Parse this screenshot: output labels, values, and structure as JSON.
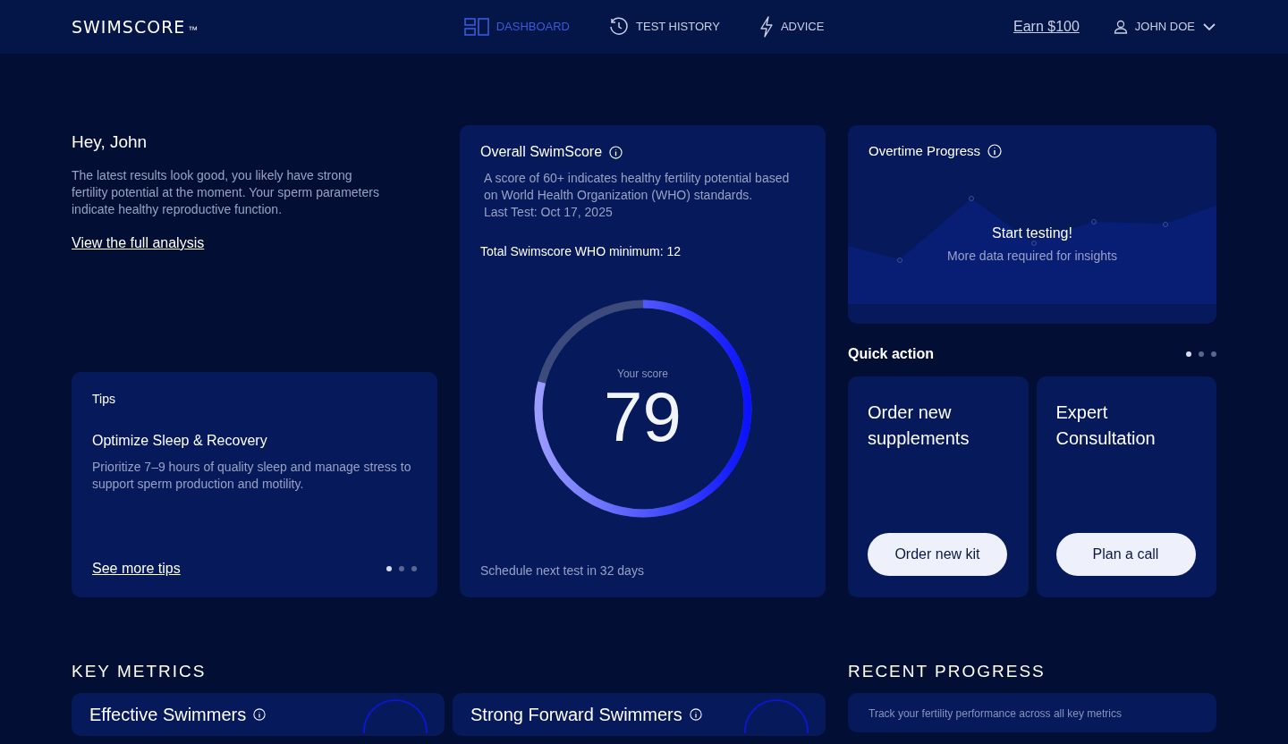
{
  "header": {
    "logo": "SWIMSCORE",
    "trademark": "™",
    "nav": [
      {
        "label": "DASHBOARD",
        "selected": true
      },
      {
        "label": "TEST HISTORY",
        "selected": false
      },
      {
        "label": "ADVICE",
        "selected": false
      }
    ],
    "referral_link": "Earn $100",
    "user": "JOHN DOE"
  },
  "greeting": {
    "title": "Hey, John",
    "text": "The latest results look good, you likely have strong fertility potential at the moment. Your sperm parameters indicate healthy reproductive function.",
    "link": "View the full analysis"
  },
  "tips": {
    "title": "Tips",
    "heading": "Optimize Sleep & Recovery",
    "text": "Prioritize 7–9 hours of quality sleep and manage stress to support sperm production and motility.",
    "link": "See more tips",
    "dots": [
      {
        "selected": true
      },
      {
        "selected": false
      },
      {
        "selected": false
      }
    ]
  },
  "score": {
    "title": "Overall SwimScore",
    "description": "A score of 60+ indicates healthy fertility potential based on World Health Organization (WHO) standards.",
    "last_test": "Last Test: Oct 17, 2025",
    "minimum": "Total Swimscore WHO minimum: 12",
    "score_label": "Your score",
    "score": "79",
    "level": 0.79,
    "footer": "Schedule next test in 32 days"
  },
  "progress": {
    "title": "Overtime Progress",
    "message": "Start testing!",
    "hint": "More data required for insights"
  },
  "quick_action": {
    "title": "Quick action",
    "dots": [
      {
        "selected": true
      },
      {
        "selected": false
      },
      {
        "selected": false
      }
    ],
    "cards": [
      {
        "title": "Order new supplements",
        "button": "Order new kit"
      },
      {
        "title": "Expert Consultation",
        "button": "Plan a call"
      }
    ]
  },
  "key_metrics": {
    "title": "KEY METRICS",
    "cards": [
      {
        "name": "Effective Swimmers"
      },
      {
        "name": "Strong Forward Swimmers"
      }
    ]
  },
  "recent_progress": {
    "title": "RECENT PROGRESS",
    "text": "Track your fertility performance across all key metrics"
  }
}
